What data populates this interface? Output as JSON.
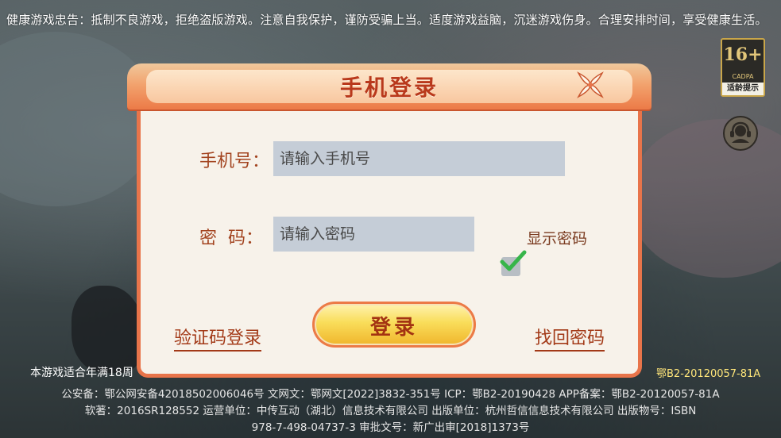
{
  "health_notice": "健康游戏忠告：抵制不良游戏，拒绝盗版游戏。注意自我保护，谨防受骗上当。适度游戏益脑，沉迷游戏伤身。合理安排时间，享受健康生活。",
  "age_badge": {
    "rating": "16+",
    "org": "CADPA",
    "caption": "适龄提示"
  },
  "support_icon": "headset-icon",
  "dialog": {
    "title": "手机登录",
    "close_icon": "close-icon",
    "phone_label": "手机号：",
    "phone_placeholder": "请输入手机号",
    "phone_value": "",
    "password_label": "密  码：",
    "password_placeholder": "请输入密码",
    "password_value": "",
    "show_password_label": "显示密码",
    "show_password_checked": true,
    "sms_login_link": "验证码登录",
    "login_button": "登录",
    "recover_password_link": "找回密码"
  },
  "footer": {
    "age_note": "本游戏适合年满18周",
    "icp_right": "鄂B2-20120057-81A",
    "line1": "公安备：鄂公网安备42018502006046号  文网文：鄂网文[2022]3832-351号  ICP：鄂B2-20190428  APP备案：鄂B2-20120057-81A",
    "line2": "软著：2016SR128552  运营单位：中传互动（湖北）信息技术有限公司  出版单位：杭州哲信信息技术有限公司  出版物号：ISBN",
    "line3": "978-7-498-04737-3  审批文号：新广出审[2018]1373号"
  },
  "colors": {
    "accent": "#e8744a",
    "title_text": "#b9391c",
    "input_bg": "#c5cdd7",
    "check_green": "#37b54a",
    "button_gold": "#f9dd5a"
  }
}
